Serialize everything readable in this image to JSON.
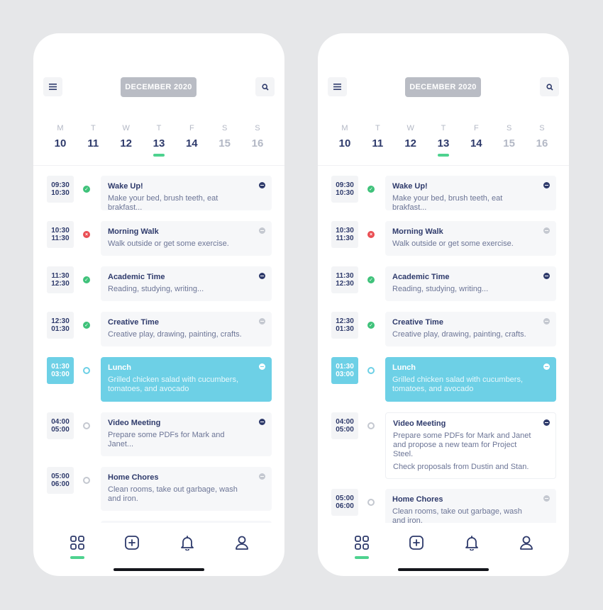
{
  "month_label": "DECEMBER 2020",
  "days": [
    {
      "letter": "M",
      "num": "10",
      "weekend": false,
      "selected": false
    },
    {
      "letter": "T",
      "num": "11",
      "weekend": false,
      "selected": false
    },
    {
      "letter": "W",
      "num": "12",
      "weekend": false,
      "selected": false
    },
    {
      "letter": "T",
      "num": "13",
      "weekend": false,
      "selected": true
    },
    {
      "letter": "F",
      "num": "14",
      "weekend": false,
      "selected": false
    },
    {
      "letter": "S",
      "num": "15",
      "weekend": true,
      "selected": false
    },
    {
      "letter": "S",
      "num": "16",
      "weekend": true,
      "selected": false
    }
  ],
  "events": [
    {
      "start": "09:30",
      "end": "10:30",
      "status": "done",
      "title": "Wake Up!",
      "desc": "Make your bed, brush teeth, eat brakfast...",
      "icon": "dark"
    },
    {
      "start": "10:30",
      "end": "11:30",
      "status": "failed",
      "title": "Morning Walk",
      "desc": "Walk outside or get some exercise.",
      "icon": "light"
    },
    {
      "start": "11:30",
      "end": "12:30",
      "status": "done",
      "title": "Academic Time",
      "desc": "Reading, studying, writing...",
      "icon": "dark"
    },
    {
      "start": "12:30",
      "end": "01:30",
      "status": "done",
      "title": "Creative Time",
      "desc": "Creative play, drawing, painting, crafts.",
      "icon": "light"
    },
    {
      "start": "01:30",
      "end": "03:00",
      "status": "current",
      "title": "Lunch",
      "desc": "Grilled chicken salad with cucumbers,\ntomatoes, and avocado",
      "icon": "white"
    },
    {
      "start": "04:00",
      "end": "05:00",
      "status": "pending",
      "title": "Video Meeting",
      "desc": "Prepare some PDFs for Mark and\nJanet...",
      "icon": "dark"
    },
    {
      "start": "05:00",
      "end": "06:00",
      "status": "pending",
      "title": "Home Chores",
      "desc": "Clean rooms, take out garbage, wash\nand iron.",
      "icon": "light"
    }
  ],
  "expanded_meeting": {
    "desc": "Prepare some PDFs for Mark and Janet\nand propose a new team for Project\nSteel.",
    "extra": "Check proposals from Dustin and Stan."
  },
  "nav": [
    {
      "name": "dashboard-icon",
      "active": true
    },
    {
      "name": "add-icon",
      "active": false
    },
    {
      "name": "bell-icon",
      "active": false
    },
    {
      "name": "profile-icon",
      "active": false
    }
  ],
  "colors": {
    "navy": "#2e3a6b",
    "accent_blue": "#6dd0e6",
    "green": "#3fc27a",
    "red": "#ea4e53",
    "month_chip": "#b9bcc4"
  }
}
